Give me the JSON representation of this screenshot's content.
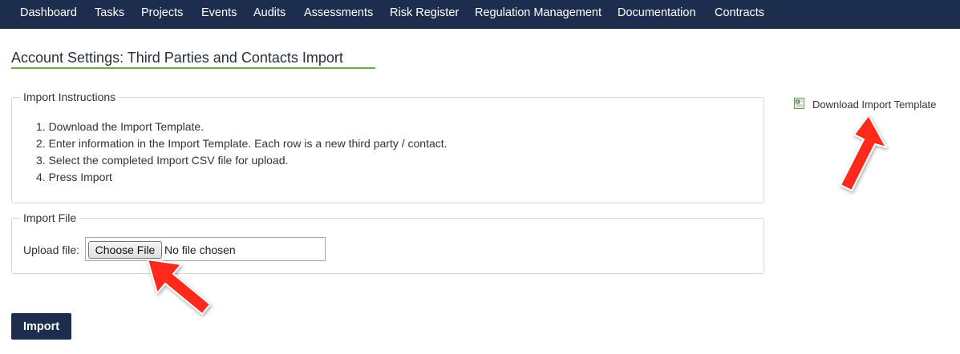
{
  "nav": {
    "items": [
      "Dashboard",
      "Tasks",
      "Projects",
      "Events",
      "Audits",
      "Assessments",
      "Risk Register",
      "Regulation Management",
      "Documentation",
      "Contracts"
    ],
    "background": "#1d2d4e"
  },
  "page": {
    "title": "Account Settings: Third Parties and Contacts Import"
  },
  "instructions": {
    "legend": "Import Instructions",
    "steps": [
      "1. Download the Import Template.",
      "2. Enter information in the Import Template. Each row is a new third party / contact.",
      "3. Select the completed Import CSV file for upload.",
      "4. Press Import"
    ]
  },
  "import_file": {
    "legend": "Import File",
    "upload_label": "Upload file:",
    "choose_button": "Choose File",
    "status": "No file chosen"
  },
  "actions": {
    "import_label": "Import"
  },
  "sidebar": {
    "download_icon": "spreadsheet-icon",
    "download_label": "Download Import Template"
  },
  "annotations": {
    "arrow_color": "#ff2a1a"
  }
}
